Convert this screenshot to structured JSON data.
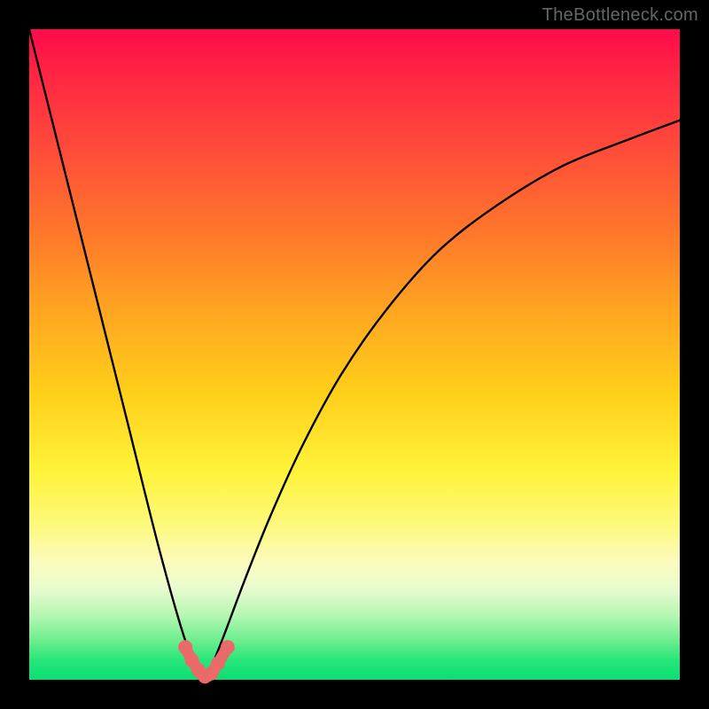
{
  "watermark": "TheBottleneck.com",
  "colors": {
    "background": "#000000",
    "gradient_top": "#ff0a4a",
    "gradient_bottom": "#09df74",
    "curve": "#000000",
    "marker_fill": "#ea6a6a",
    "marker_stroke": "#c94c4c"
  },
  "chart_data": {
    "type": "line",
    "title": "",
    "xlabel": "",
    "ylabel": "",
    "xlim": [
      0,
      100
    ],
    "ylim": [
      0,
      100
    ],
    "grid": false,
    "legend": false,
    "note": "Bottleneck-style V-curve. y is mismatch percentage (100 = worst / red at top, 0 = best / green at bottom). Minimum occurs near x ≈ 27. No axis ticks or numeric labels are drawn in the source image; values below are read off by shape.",
    "series": [
      {
        "name": "main-curve",
        "x": [
          0,
          5,
          10,
          15,
          20,
          24,
          26,
          27,
          28,
          30,
          33,
          37,
          42,
          48,
          55,
          63,
          72,
          82,
          92,
          100
        ],
        "y": [
          100,
          80,
          60,
          40,
          20,
          6,
          2,
          0,
          2,
          7,
          15,
          25,
          36,
          47,
          57,
          66,
          73,
          79,
          83,
          86
        ]
      }
    ],
    "markers": {
      "name": "near-minimum-dots",
      "x": [
        24.0,
        25.0,
        26.0,
        27.0,
        28.0,
        29.0,
        30.5
      ],
      "y": [
        5.0,
        3.0,
        1.5,
        0.5,
        1.0,
        2.5,
        5.0
      ]
    }
  }
}
